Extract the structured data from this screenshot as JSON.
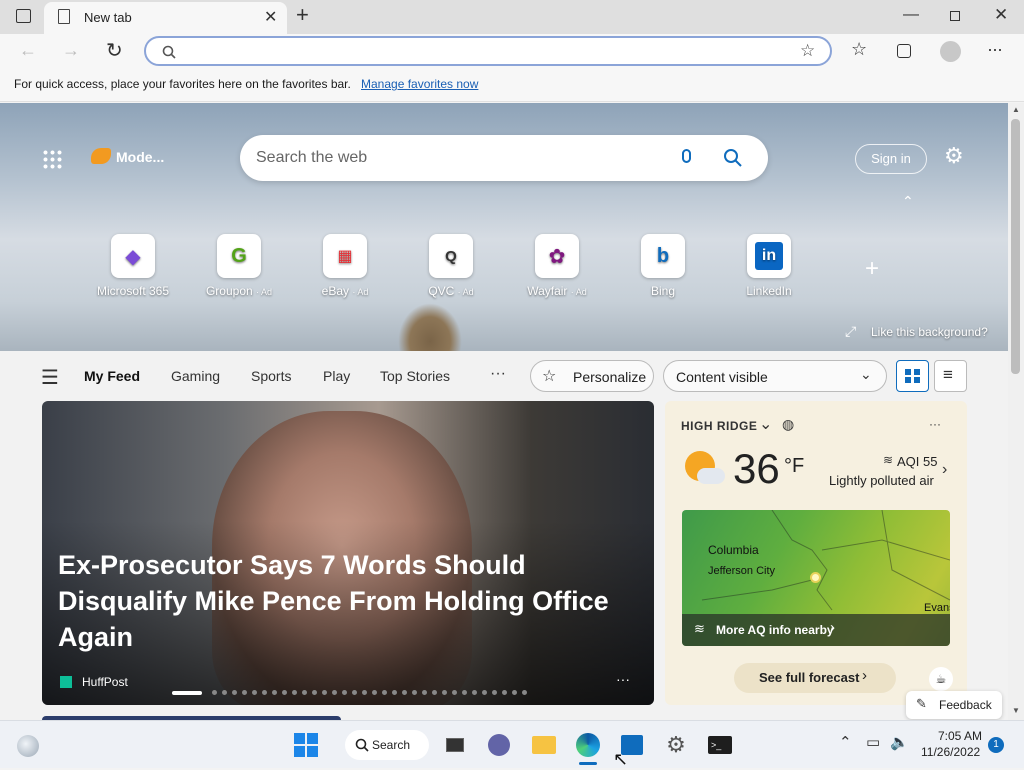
{
  "browser": {
    "tab_title": "New tab",
    "favorites_message": "For quick access, place your favorites here on the favorites bar.",
    "manage_favorites": "Manage favorites now"
  },
  "hero": {
    "mode_label": "Mode...",
    "search_placeholder": "Search the web",
    "sign_in": "Sign in",
    "like_background": "Like this background?",
    "quick_links": [
      {
        "label": "Microsoft 365",
        "ad": ""
      },
      {
        "label": "Groupon",
        "ad": "· Ad"
      },
      {
        "label": "eBay",
        "ad": "· Ad"
      },
      {
        "label": "QVC",
        "ad": "· Ad"
      },
      {
        "label": "Wayfair",
        "ad": "· Ad"
      },
      {
        "label": "Bing",
        "ad": ""
      },
      {
        "label": "LinkedIn",
        "ad": ""
      }
    ]
  },
  "feed": {
    "tabs": [
      "My Feed",
      "Gaming",
      "Sports",
      "Play",
      "Top Stories"
    ],
    "more": "···",
    "personalize": "Personalize",
    "content_visible": "Content visible",
    "headline": "Ex-Prosecutor Says 7 Words Should Disqualify Mike Pence From Holding Office Again",
    "source": "HuffPost"
  },
  "weather": {
    "location": "HIGH RIDGE",
    "temp": "36",
    "unit": "°F",
    "aqi": "AQI 55",
    "aqi_desc": "Lightly polluted air",
    "map_labels": [
      "Columbia",
      "Jefferson City",
      "Evans"
    ],
    "aq_link": "More AQ info nearby",
    "forecast_button": "See full forecast"
  },
  "feedback": "Feedback",
  "taskbar": {
    "search": "Search",
    "time": "7:05 AM",
    "date": "11/26/2022",
    "badge": "1"
  }
}
